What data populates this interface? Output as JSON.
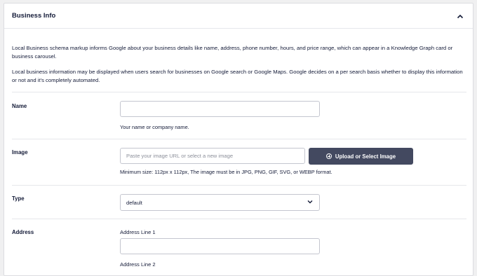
{
  "panel": {
    "title": "Business Info",
    "collapse_icon": "chevron-up-icon"
  },
  "intro": {
    "paragraph1": "Local Business schema markup informs Google about your business details like name, address, phone number, hours, and price range, which can appear in a Knowledge Graph card or business carousel.",
    "paragraph2": "Local business information may be displayed when users search for businesses on Google search or Google Maps. Google decides on a per search basis whether to display this information or not and it's completely automated."
  },
  "name_row": {
    "label": "Name",
    "value": "",
    "help": "Your name or company name."
  },
  "image_row": {
    "label": "Image",
    "placeholder": "Paste your image URL or select a new image",
    "button_label": "Upload or Select Image",
    "button_icon": "plus-circle-icon",
    "help": "Minimum size: 112px x 112px, The image must be in JPG, PNG, GIF, SVG, or WEBP format."
  },
  "type_row": {
    "label": "Type",
    "selected": "default",
    "dropdown_icon": "chevron-down-icon"
  },
  "address_row": {
    "label": "Address",
    "line1_label": "Address Line 1",
    "line1_value": "",
    "line2_label": "Address Line 2"
  },
  "colors": {
    "button_bg": "#434960",
    "text": "#141b38",
    "border": "#c4c6cf"
  }
}
